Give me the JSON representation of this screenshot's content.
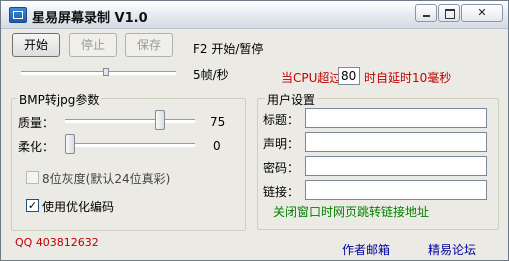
{
  "window": {
    "title": "星易屏幕录制 V1.0"
  },
  "toolbar": {
    "start_label": "开始",
    "stop_label": "停止",
    "save_label": "保存",
    "hotkey_text": "F2 开始/暂停",
    "fps_text": "5帧/秒",
    "fps_level": 0.55
  },
  "cpu": {
    "prefix": "当CPU超过",
    "value": "80",
    "suffix": "时自延时10毫秒"
  },
  "bmp": {
    "group_title": "BMP转jpg参数",
    "quality_label": "质量：",
    "quality_value": "75",
    "quality_level": 0.75,
    "soften_label": "柔化：",
    "soften_value": "0",
    "soften_level": 0,
    "gray_label": "8位灰度(默认24位真彩)",
    "gray_checked": false,
    "optimize_label": "使用优化编码",
    "optimize_checked": true
  },
  "user": {
    "group_title": "用户设置",
    "title_label": "标题：",
    "statement_label": "声明：",
    "password_label": "密码：",
    "link_label": "链接：",
    "title_value": "",
    "statement_value": "",
    "password_value": "",
    "link_value": "",
    "close_hint": "关闭窗口时网页跳转链接地址"
  },
  "footer": {
    "qq": "QQ 403812632",
    "author_mail": "作者邮箱",
    "forum": "精易论坛"
  },
  "colors": {
    "red": "#c00000",
    "green": "#008000",
    "link_blue": "#0000a0"
  }
}
